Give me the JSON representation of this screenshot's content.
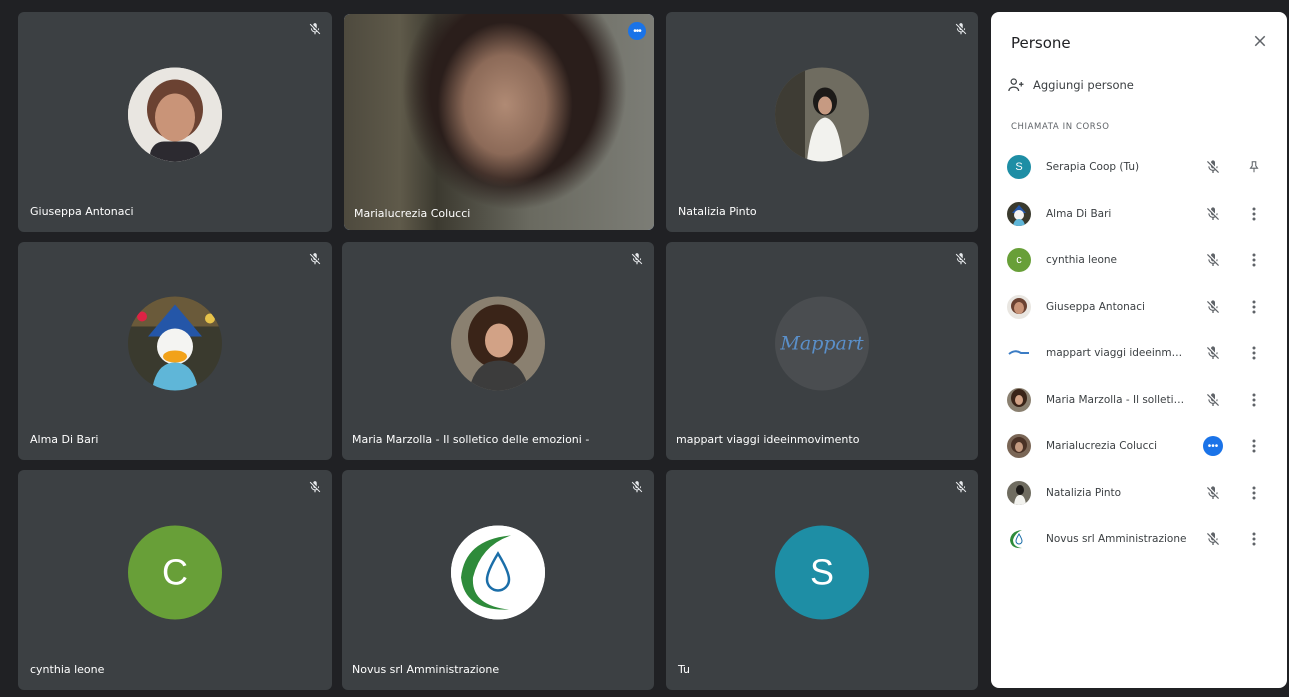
{
  "colors": {
    "background": "#202124",
    "tile": "#3c4043",
    "accent_blue": "#1a73e8",
    "active_border": "#8ab4f8",
    "green_avatar": "#689f38",
    "teal_avatar": "#1e8ea5"
  },
  "tiles": [
    {
      "name": "Giuseppa Antonaci",
      "avatar": "photo-woman-short-hair"
    },
    {
      "name": "Marialucrezia Colucci",
      "avatar": "live-video"
    },
    {
      "name": "Natalizia Pinto",
      "avatar": "photo-woman-standing"
    },
    {
      "name": "Alma Di Bari",
      "avatar": "photo-donald-duck"
    },
    {
      "name": "Maria Marzolla - Il solletico delle emozioni -",
      "avatar": "photo-woman-curly-hair"
    },
    {
      "name": "mappart viaggi ideeinmovimento",
      "avatar": "mappart-logo"
    },
    {
      "name": "cynthia leone",
      "avatar_letter": "C"
    },
    {
      "name": "Novus srl Amministrazione",
      "avatar": "novus-drop-logo"
    },
    {
      "name": "Tu",
      "avatar_letter": "S"
    }
  ],
  "mappart_logo_text": "Mappart",
  "panel": {
    "title": "Persone",
    "add_people": "Aggiungi persone",
    "section": "CHIAMATA IN CORSO",
    "participants": [
      {
        "name": "Serapia Coop (Tu)",
        "letter": "S",
        "action": "pin-icon"
      },
      {
        "name": "Alma Di Bari",
        "action": "more-vert-icon"
      },
      {
        "name": "cynthia leone",
        "letter": "c",
        "action": "more-vert-icon"
      },
      {
        "name": "Giuseppa Antonaci",
        "action": "more-vert-icon"
      },
      {
        "name": "mappart viaggi ideeinmovi...",
        "action": "more-vert-icon"
      },
      {
        "name": "Maria Marzolla - Il solletico ...",
        "action": "more-vert-icon"
      },
      {
        "name": "Marialucrezia Colucci",
        "speaking": true,
        "action": "more-vert-icon"
      },
      {
        "name": "Natalizia Pinto",
        "action": "more-vert-icon"
      },
      {
        "name": "Novus srl Amministrazione",
        "action": "more-vert-icon"
      }
    ]
  }
}
